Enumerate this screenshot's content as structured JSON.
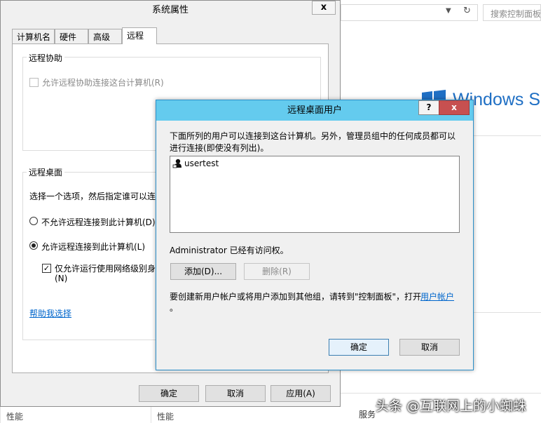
{
  "background_window": {
    "search_placeholder": "搜索控制面板",
    "brand_text": "Windows Server",
    "services_col": "服务",
    "left_col_1": "性能",
    "left_col_2": "性能"
  },
  "system_properties": {
    "title": "系统属性",
    "close_label": "x",
    "tabs": [
      {
        "label": "计算机名"
      },
      {
        "label": "硬件"
      },
      {
        "label": "高级"
      },
      {
        "label": "远程",
        "active": true
      }
    ],
    "remote_assistance": {
      "legend": "远程协助",
      "allow_checkbox_label": "允许远程协助连接这台计算机(R)",
      "checked": false,
      "enabled": false
    },
    "remote_desktop": {
      "legend": "远程桌面",
      "instruction": "选择一个选项，然后指定谁可以连",
      "option_deny": "不允许远程连接到此计算机(D)",
      "option_allow": "允许远程连接到此计算机(L)",
      "selected": "allow",
      "nla_checkbox_label": "仅允许运行使用网络级别身份",
      "nla_checkbox_label_cont": "(N)",
      "nla_checked": true,
      "help_link": "帮助我选择"
    },
    "buttons": {
      "ok": "确定",
      "cancel": "取消",
      "apply": "应用(A)"
    }
  },
  "remote_desktop_users": {
    "title": "远程桌面用户",
    "help_label": "?",
    "close_label": "x",
    "description_line1": "下面所列的用户可以连接到这台计算机。另外，管理员组中的任何成员都可以",
    "description_line2": "进行连接(即使没有列出)。",
    "users": [
      "usertest"
    ],
    "access_note": "Administrator 已经有访问权。",
    "add_button": "添加(D)...",
    "remove_button": "删除(R)",
    "footer_text": "要创建新用户帐户或将用户添加到其他组，请转到\"控制面板\"，打开",
    "footer_link": "用户帐户",
    "footer_end": "。",
    "ok_button": "确定",
    "cancel_button": "取消"
  },
  "watermark": "头条 @互联网上的小蜘蛛",
  "colors": {
    "titlebar_active": "#64cbee",
    "close_red": "#c75050",
    "link_blue": "#0066cc",
    "brand_blue": "#1f6fc4"
  }
}
